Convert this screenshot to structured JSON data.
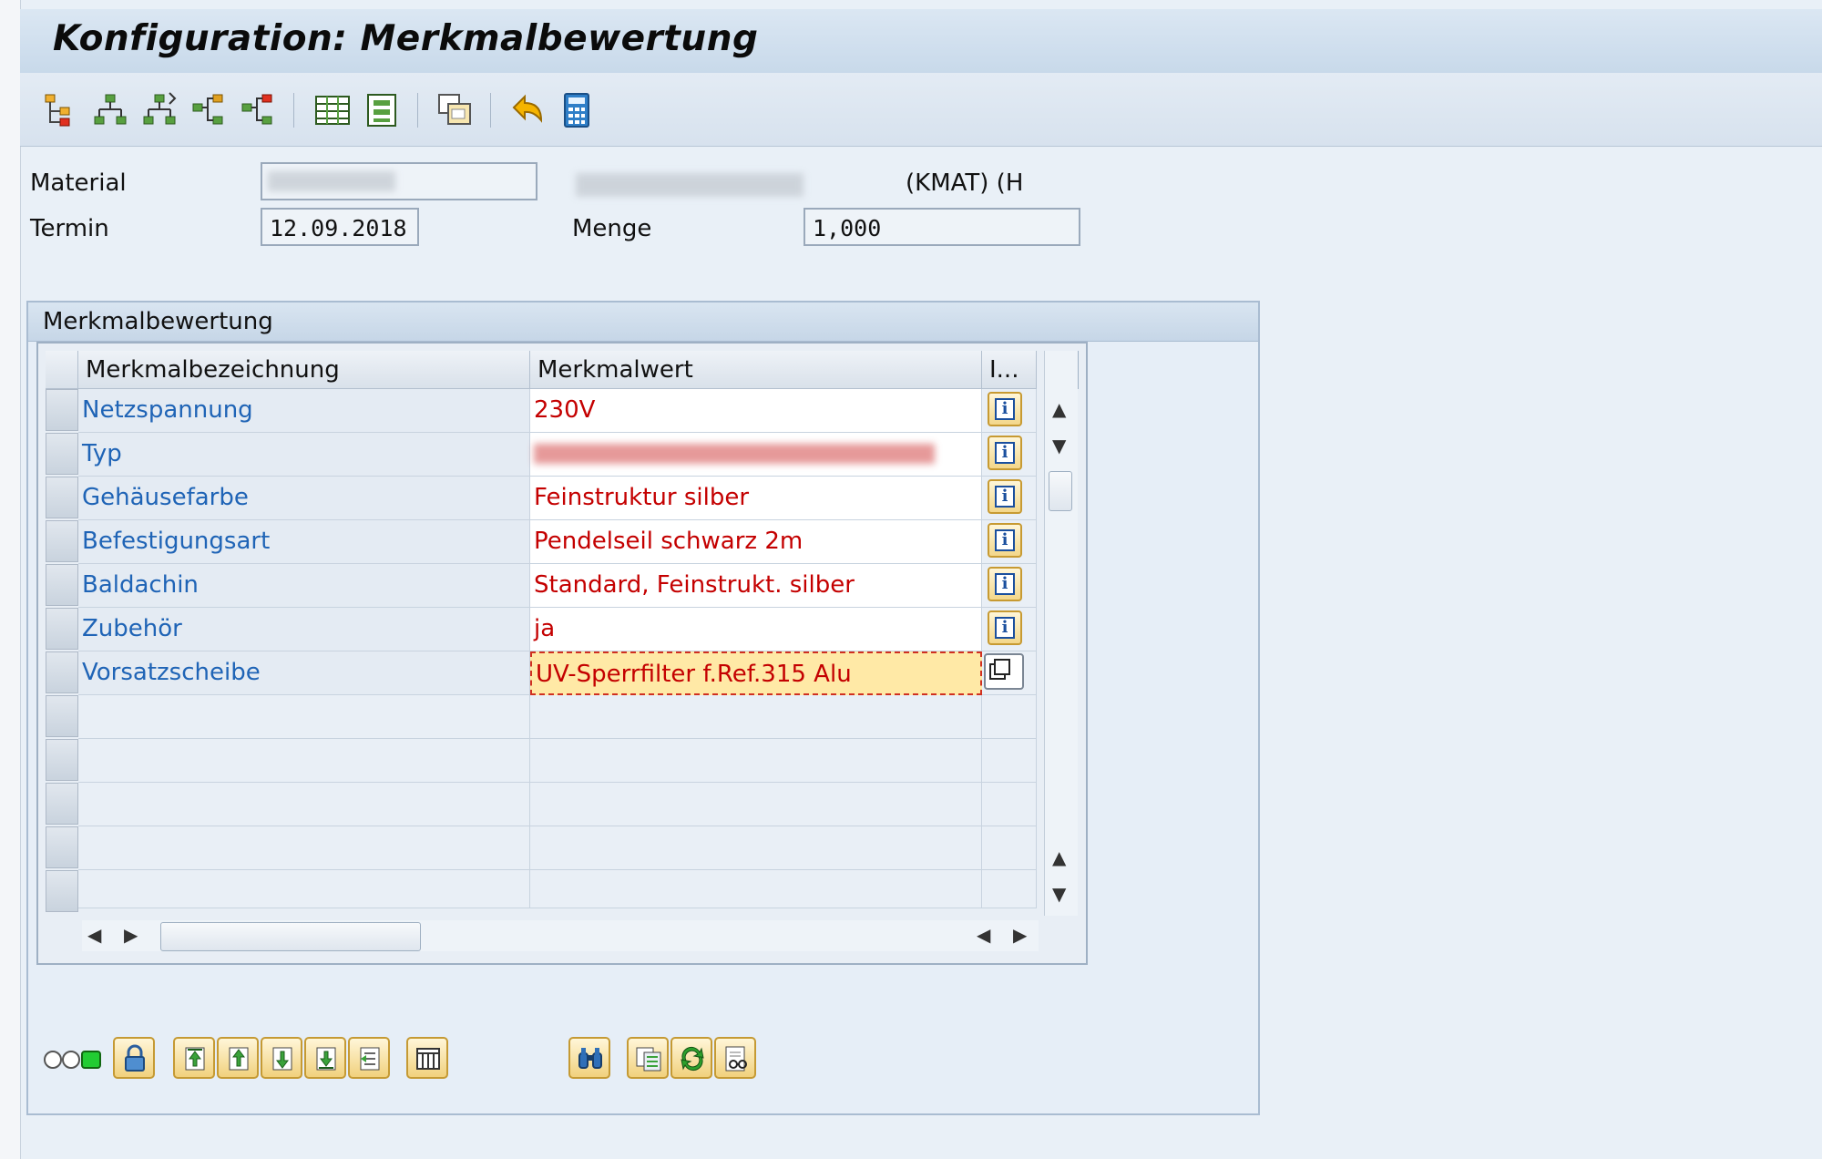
{
  "window": {
    "title": "Konfiguration: Merkmalbewertung"
  },
  "toolbar": {
    "icons": [
      "tree-structure-icon",
      "add-node-icon",
      "add-child-node-icon",
      "move-node-icon",
      "copy-node-icon",
      "table-view-icon",
      "form-view-icon",
      "copy-window-icon",
      "undo-arrow-icon",
      "calculator-icon"
    ]
  },
  "header": {
    "material_label": "Material",
    "material_value": "",
    "material_suffix": "(KMAT)  (H",
    "termin_label": "Termin",
    "termin_value": "12.09.2018",
    "menge_label": "Menge",
    "menge_value": "1,000"
  },
  "group": {
    "title": "Merkmalbewertung"
  },
  "table": {
    "columns": [
      "Merkmalbezeichnung",
      "Merkmalwert",
      "I..."
    ],
    "rows": [
      {
        "name": "Netzspannung",
        "value": "230V",
        "action": "info"
      },
      {
        "name": "Typ",
        "value": "",
        "action": "info"
      },
      {
        "name": "Gehäusefarbe",
        "value": "Feinstruktur silber",
        "action": "info"
      },
      {
        "name": "Befestigungsart",
        "value": "Pendelseil schwarz 2m",
        "action": "info"
      },
      {
        "name": "Baldachin",
        "value": "Standard, Feinstrukt. silber",
        "action": "info"
      },
      {
        "name": "Zubehör",
        "value": "ja",
        "action": "info"
      },
      {
        "name": "Vorsatzscheibe",
        "value": "UV-Sperrfilter f.Ref.315 Alu",
        "action": "copy"
      }
    ],
    "empty_rows": 5
  },
  "colors": {
    "name_text": "#1f64b6",
    "value_text": "#c40000",
    "selected_cell": "#ffe9a6"
  }
}
